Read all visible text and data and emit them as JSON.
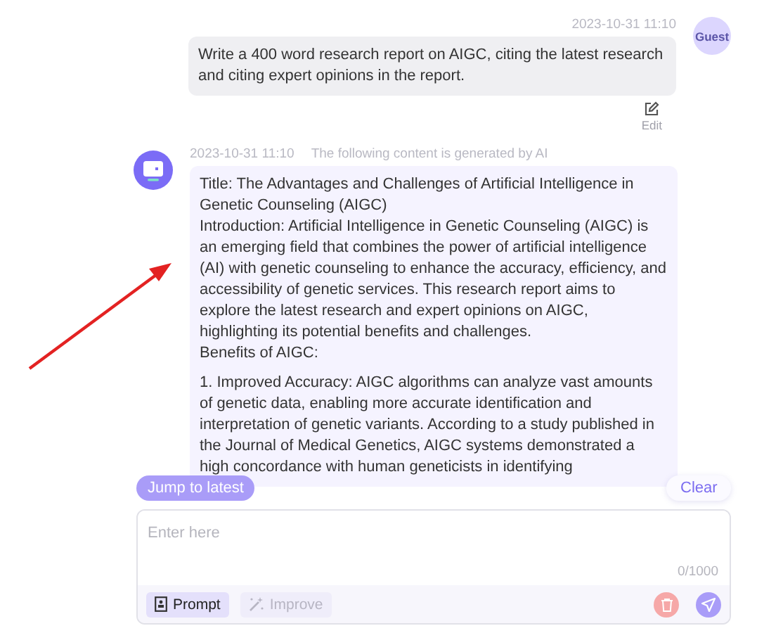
{
  "messages": [
    {
      "kind": "user",
      "time": "2023-10-31 11:10",
      "avatar_label": "Guest",
      "blocks": [
        [
          "Write a 400 word research report on AIGC, citing the latest research and citing expert opinions in the report."
        ]
      ],
      "action": "Edit"
    },
    {
      "kind": "ai",
      "time": "2023-10-31 11:10",
      "note": "The following content is generated by AI",
      "blocks": [
        [
          "Title: The Advantages and Challenges of Artificial Intelligence in Genetic Counseling (AIGC)",
          "Introduction: Artificial Intelligence in Genetic Counseling (AIGC) is an emerging field that combines the power of artificial intelligence (AI) with genetic counseling to enhance the accuracy, efficiency, and accessibility of genetic services. This research report aims to explore the latest research and expert opinions on AIGC, highlighting its potential benefits and challenges.",
          "Benefits of AIGC:"
        ],
        [
          "1. Improved Accuracy: AIGC algorithms can analyze vast amounts of genetic data, enabling more accurate identification and interpretation of genetic variants. According to a study published in the Journal of Medical Genetics, AIGC systems demonstrated a high concordance with human geneticists in identifying"
        ]
      ]
    }
  ],
  "jump_button": "Jump to latest",
  "clear_button": "Clear",
  "composer": {
    "placeholder": "Enter here",
    "counter": "0/1000",
    "tools": [
      {
        "kind": "prompt",
        "label": "Prompt",
        "disabled": false
      },
      {
        "kind": "improve",
        "label": "Improve",
        "disabled": true
      }
    ]
  }
}
